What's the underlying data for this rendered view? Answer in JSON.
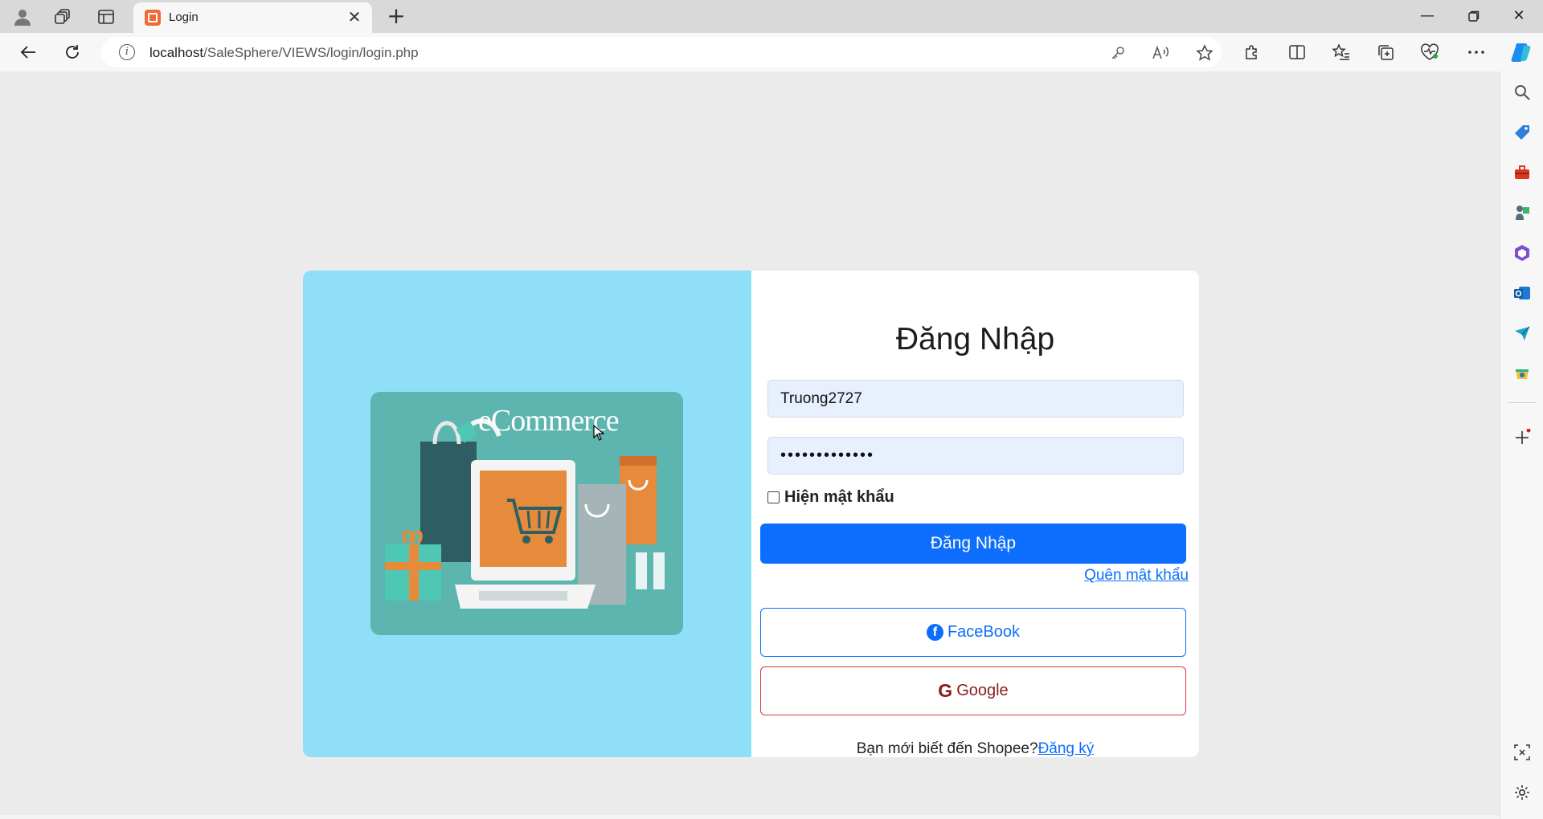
{
  "browser": {
    "tab": {
      "title": "Login"
    },
    "address": {
      "url_host": "localhost",
      "url_path": "/SaleSphere/VIEWS/login/login.php"
    }
  },
  "page": {
    "hero": {
      "art_text": "eCommerce"
    },
    "form": {
      "title": "Đăng Nhập",
      "username_value": "Truong2727",
      "password_value": "•••••••••••••",
      "show_password_label": "Hiện mật khẩu",
      "show_password_checked": false,
      "login_button": "Đăng Nhập",
      "forgot_link": "Quên mật khẩu",
      "facebook_button": "FaceBook",
      "google_button": "Google",
      "signup_prompt": "Bạn mới biết đến Shopee?",
      "signup_link": "Đăng ký"
    }
  },
  "colors": {
    "primary": "#0d6efd",
    "danger": "#dc3545",
    "hero_bg": "#8fdff8",
    "field_bg": "#e8f0fe"
  },
  "icons": {
    "titlebar": [
      "profile-icon",
      "workspaces-icon",
      "tab-actions-icon"
    ],
    "toolbar": [
      "back-icon",
      "refresh-icon",
      "info-icon",
      "key-icon",
      "read-aloud-icon",
      "favorite-star-icon",
      "extensions-icon",
      "split-screen-icon",
      "favorites-icon",
      "collections-icon",
      "browser-essentials-icon",
      "more-icon",
      "copilot-icon"
    ],
    "sidebar": [
      "search-icon",
      "shopping-icon",
      "tools-icon",
      "games-icon",
      "microsoft365-icon",
      "outlook-icon",
      "send-icon",
      "drop-icon",
      "add-icon",
      "screenshot-icon",
      "settings-icon"
    ]
  }
}
